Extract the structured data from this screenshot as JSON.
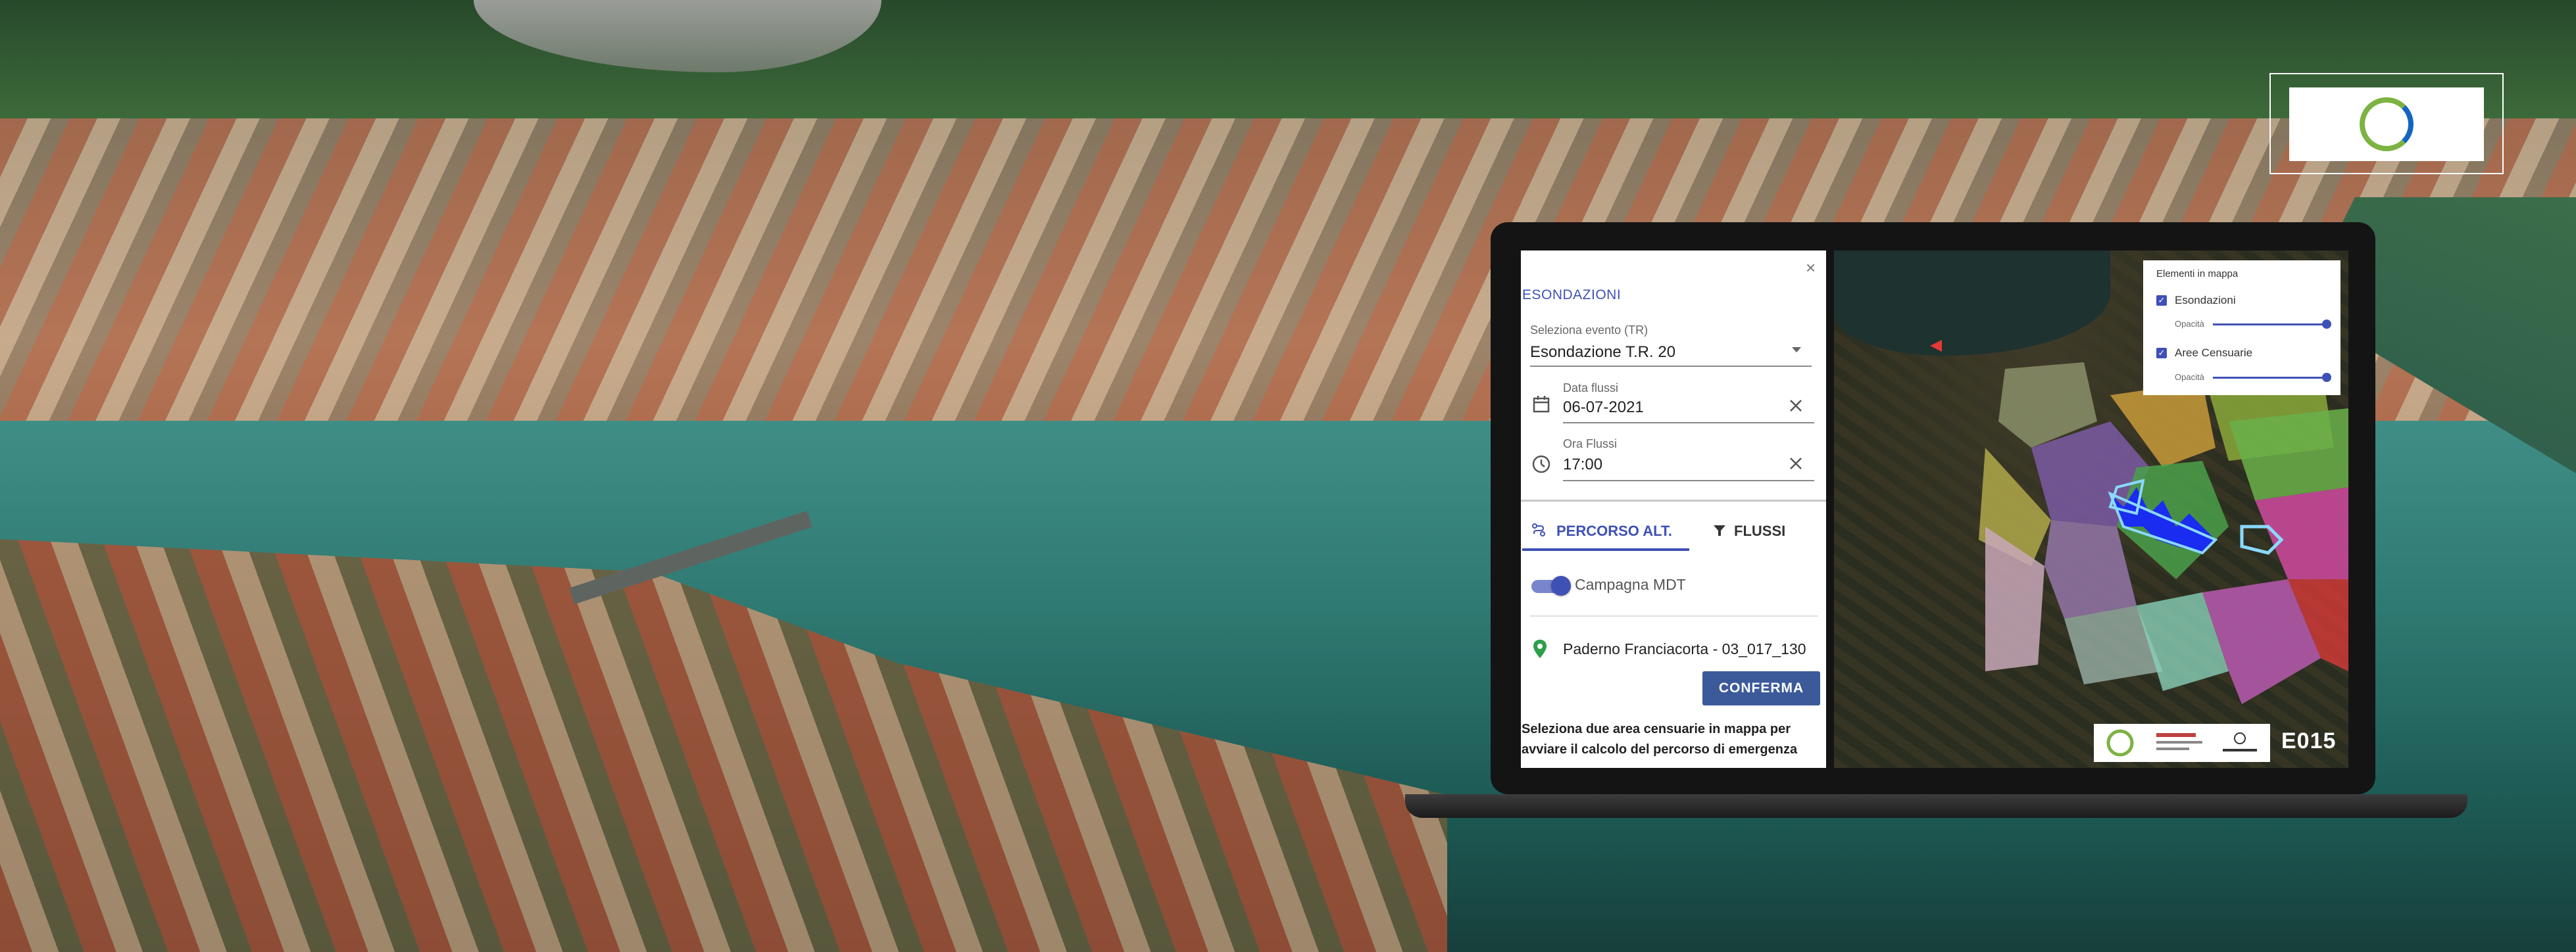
{
  "panel": {
    "close": "×",
    "title": "ESONDAZIONI",
    "event": {
      "label": "Seleziona evento (TR)",
      "value": "Esondazione T.R. 20"
    },
    "date": {
      "label": "Data flussi",
      "value": "06-07-2021"
    },
    "time": {
      "label": "Ora Flussi",
      "value": "17:00"
    },
    "tabs": [
      {
        "label": "PERCORSO ALT."
      },
      {
        "label": "FLUSSI"
      }
    ],
    "toggle": {
      "label": "Campagna MDT",
      "on": true
    },
    "location": {
      "value": "Paderno Franciacorta - 03_017_130"
    },
    "confirm_label": "CONFERMA",
    "note": "Seleziona due area censuarie in mappa per avviare il calcolo del percorso di emergenza"
  },
  "map": {
    "legend": {
      "title": "Elementi in mappa",
      "items": [
        {
          "label": "Esondazioni",
          "checked": true,
          "opacity_label": "Opacità",
          "opacity": 1.0
        },
        {
          "label": "Aree Censuarie",
          "checked": true,
          "opacity_label": "Opacità",
          "opacity": 1.0
        }
      ]
    },
    "partner_brand": "E015",
    "marker_color": "#e53935"
  },
  "colors": {
    "accent": "#3f51b5",
    "button": "#3c5a9a",
    "flood": "#1a2cf0"
  }
}
